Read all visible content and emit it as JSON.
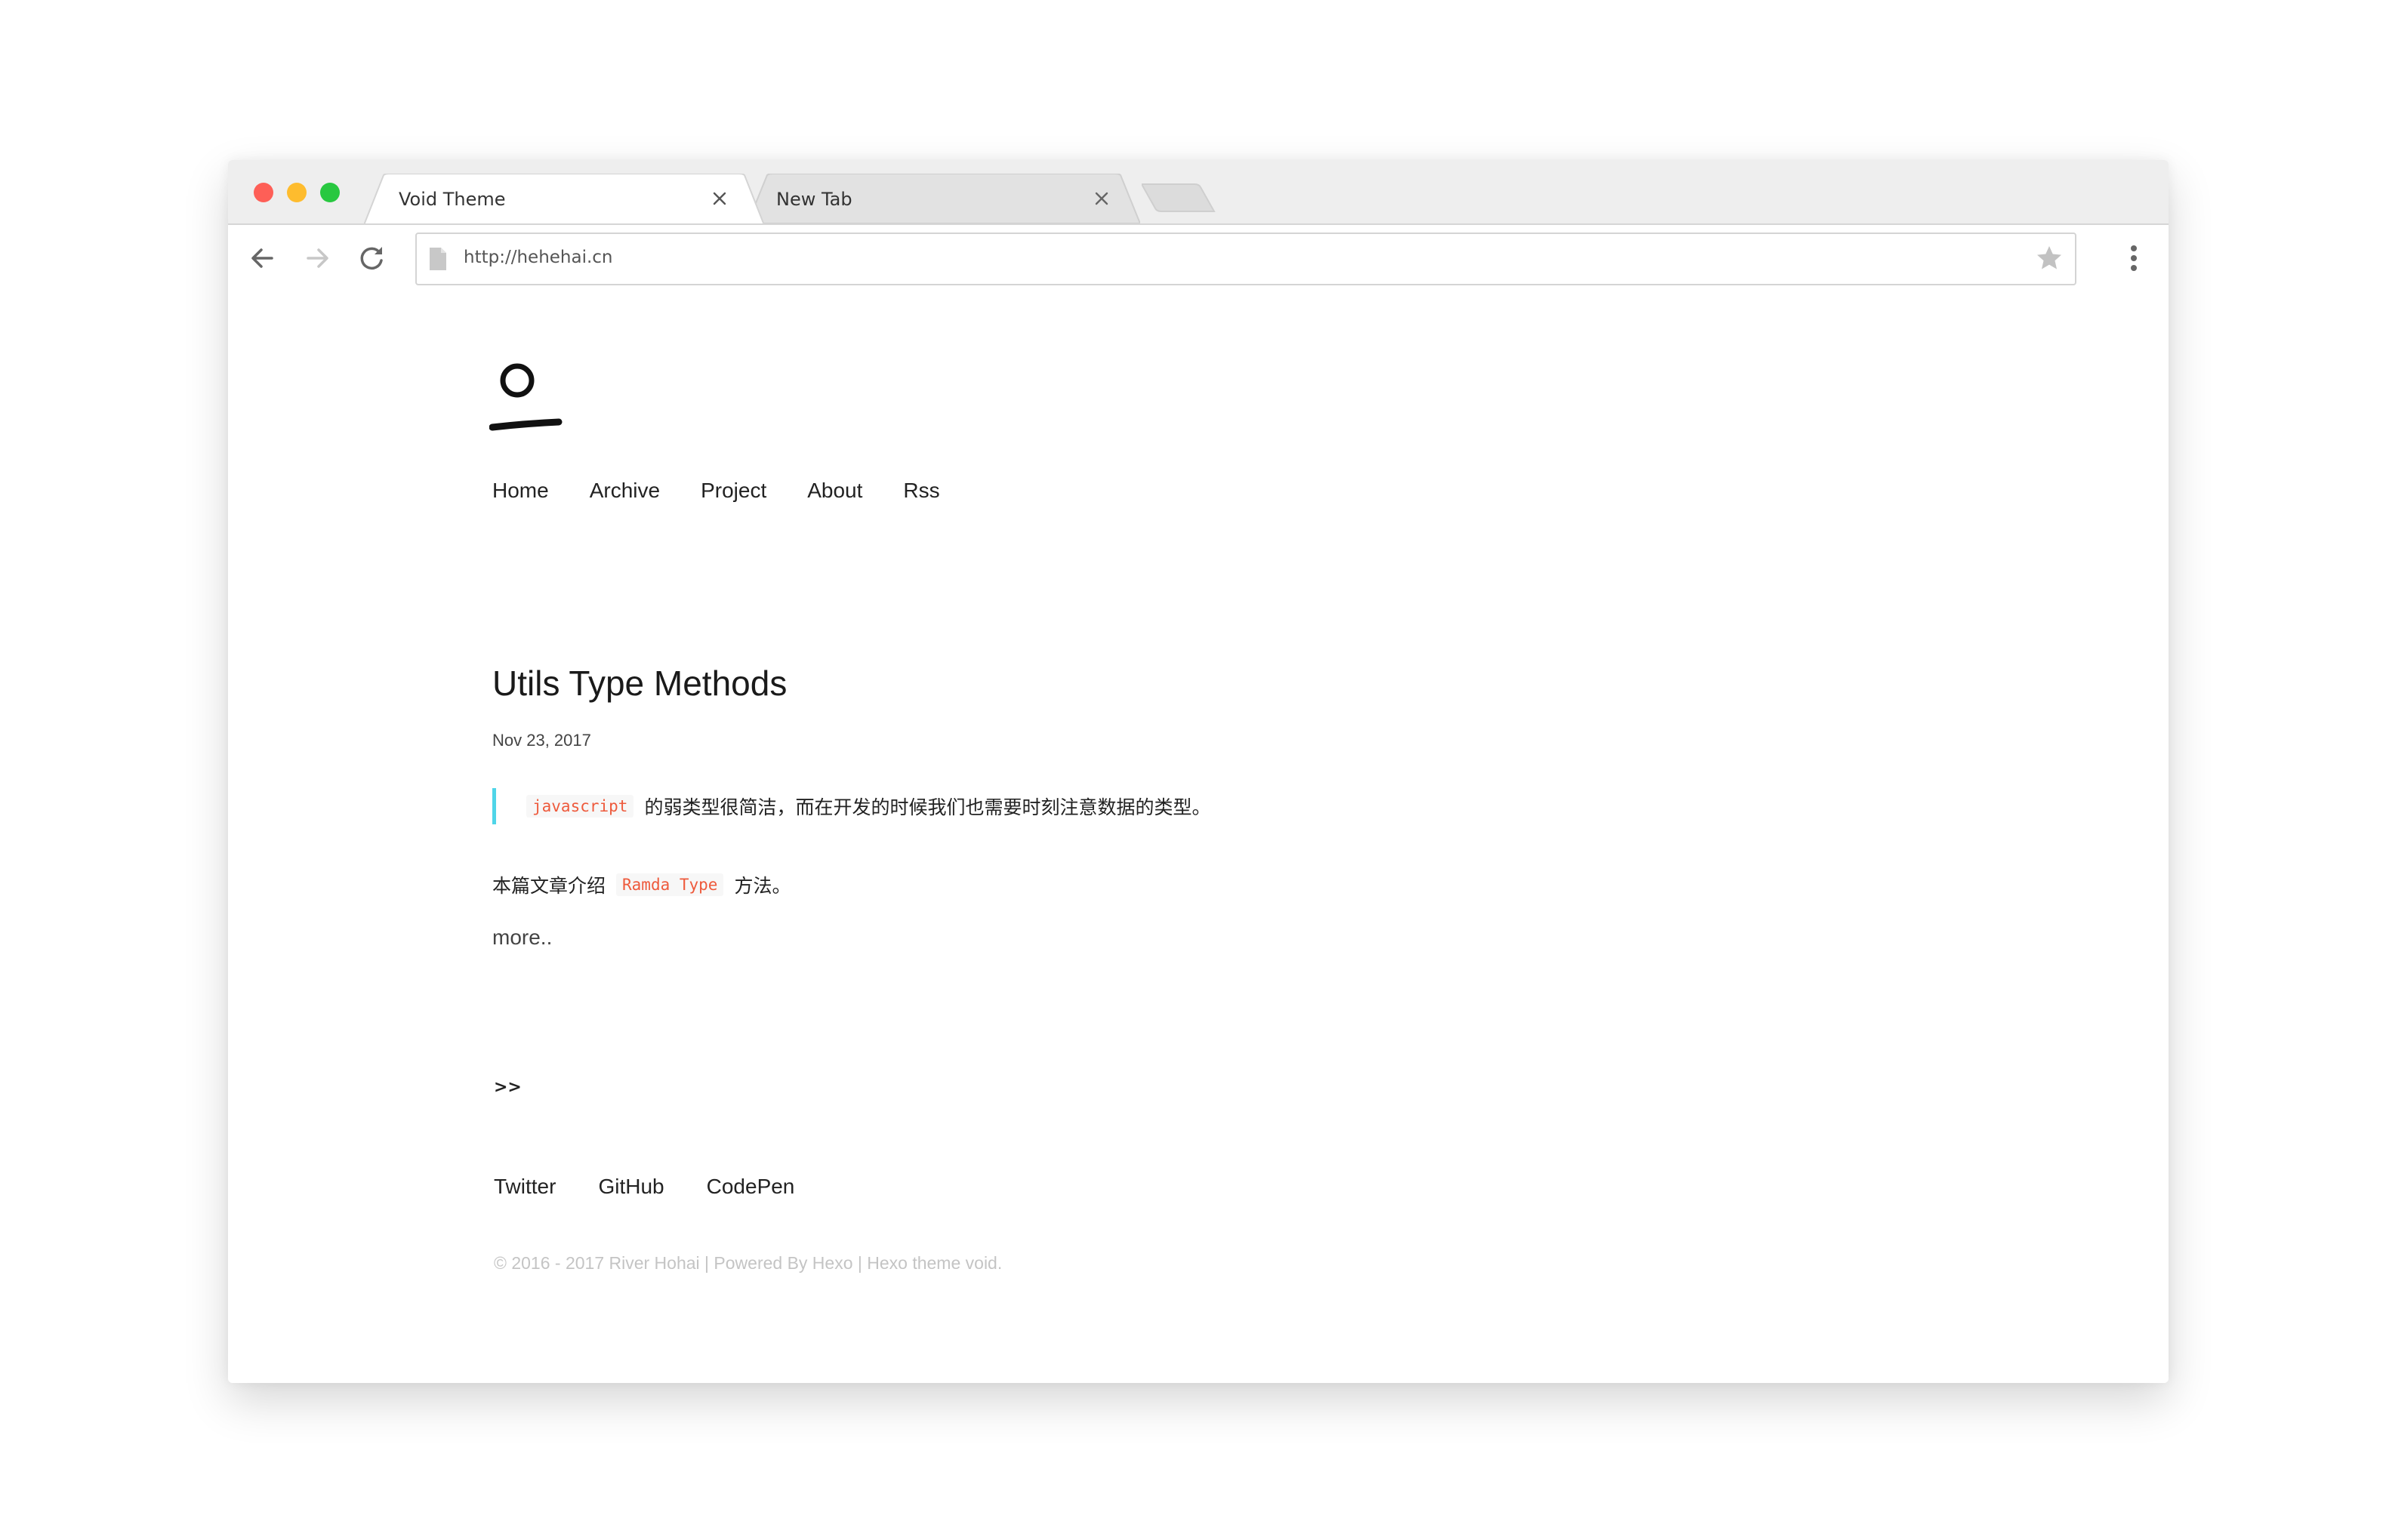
{
  "tabs": [
    {
      "title": "Void Theme",
      "active": true
    },
    {
      "title": "New Tab",
      "active": false
    }
  ],
  "address_bar": {
    "url": "http://hehehai.cn"
  },
  "icons": {
    "back": "arrow-left-icon",
    "forward": "arrow-right-icon",
    "reload": "reload-icon",
    "page": "page-icon",
    "bookmark": "star-icon",
    "menu": "kebab-menu-icon",
    "close_tab": "close-icon"
  },
  "colors": {
    "close_button": "#fe5f57",
    "minimize_button": "#febc2e",
    "maximize_button": "#28c840",
    "quote_border": "#4fd5e8",
    "inline_code": "#ee5a3c"
  },
  "site": {
    "nav": [
      "Home",
      "Archive",
      "Project",
      "About",
      "Rss"
    ]
  },
  "post": {
    "title": "Utils Type Methods",
    "date": "Nov 23, 2017",
    "quote_code": "javascript",
    "quote_text": "的弱类型很简洁，而在开发的时候我们也需要时刻注意数据的类型。",
    "intro_before": "本篇文章介绍",
    "intro_code": "Ramda Type",
    "intro_after": "方法。",
    "more": "more.."
  },
  "pagination": {
    "next": ">>"
  },
  "social": [
    "Twitter",
    "GitHub",
    "CodePen"
  ],
  "footer": "© 2016 - 2017 River Hohai | Powered By Hexo | Hexo theme void."
}
